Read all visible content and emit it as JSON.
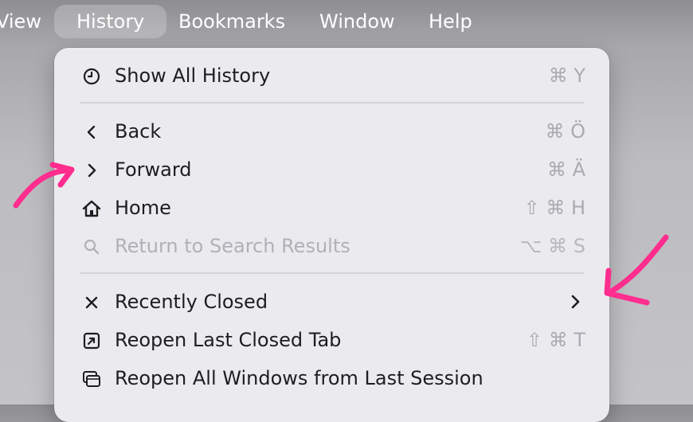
{
  "menubar": {
    "view": "View",
    "history": "History",
    "bookmarks": "Bookmarks",
    "window": "Window",
    "help": "Help"
  },
  "menu": {
    "items": [
      {
        "label": "Show All History",
        "shortcut": "⌘ Y",
        "icon": "clock-icon"
      },
      {
        "label": "Back",
        "shortcut": "⌘ Ö",
        "icon": "chevron-left-icon"
      },
      {
        "label": "Forward",
        "shortcut": "⌘ Ä",
        "icon": "chevron-right-icon"
      },
      {
        "label": "Home",
        "shortcut": "⇧ ⌘ H",
        "icon": "house-icon"
      },
      {
        "label": "Return to Search Results",
        "shortcut": "⌥ ⌘ S",
        "icon": "magnifier-icon",
        "disabled": true
      },
      {
        "label": "Recently Closed",
        "shortcut": "",
        "icon": "close-x-icon",
        "submenu": true
      },
      {
        "label": "Reopen Last Closed Tab",
        "shortcut": "⇧ ⌘ T",
        "icon": "arrow-up-right-square-icon"
      },
      {
        "label": "Reopen All Windows from Last Session",
        "shortcut": "",
        "icon": "stacked-windows-icon"
      }
    ]
  },
  "colors": {
    "menu_bg": "#ebebef",
    "text": "#1e1e1e",
    "shortcut": "#aaaab0",
    "disabled": "#b0b0b6",
    "annotation": "#ff2d8e"
  }
}
